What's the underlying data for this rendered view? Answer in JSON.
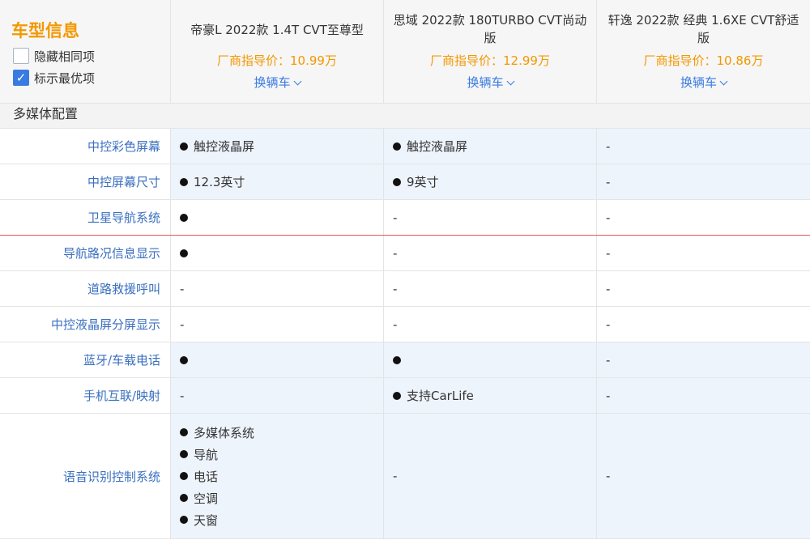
{
  "header": {
    "title": "车型信息",
    "hide_same_label": "隐藏相同项",
    "mark_best_label": "标示最优项",
    "hide_same_checked": false,
    "mark_best_checked": true
  },
  "cars": [
    {
      "name": "帝豪L 2022款 1.4T CVT至尊型",
      "price": "厂商指导价：10.99万",
      "switch": "换辆车"
    },
    {
      "name": "思域 2022款 180TURBO CVT尚动版",
      "price": "厂商指导价：12.99万",
      "switch": "换辆车"
    },
    {
      "name": "轩逸 2022款 经典 1.6XE CVT舒适版",
      "price": "厂商指导价：10.86万",
      "switch": "换辆车"
    }
  ],
  "section": {
    "title": "多媒体配置"
  },
  "rows": [
    {
      "label": "中控彩色屏幕",
      "values": [
        {
          "dot": true,
          "text": "触控液晶屏"
        },
        {
          "dot": true,
          "text": "触控液晶屏"
        },
        {
          "dot": false,
          "text": "-"
        }
      ]
    },
    {
      "label": "中控屏幕尺寸",
      "values": [
        {
          "dot": true,
          "text": "12.3英寸"
        },
        {
          "dot": true,
          "text": "9英寸"
        },
        {
          "dot": false,
          "text": "-"
        }
      ]
    },
    {
      "label": "卫星导航系统",
      "values": [
        {
          "dot": true,
          "text": ""
        },
        {
          "dot": false,
          "text": "-"
        },
        {
          "dot": false,
          "text": "-"
        }
      ]
    },
    {
      "label": "导航路况信息显示",
      "values": [
        {
          "dot": true,
          "text": ""
        },
        {
          "dot": false,
          "text": "-"
        },
        {
          "dot": false,
          "text": "-"
        }
      ]
    },
    {
      "label": "道路救援呼叫",
      "values": [
        {
          "dot": false,
          "text": "-"
        },
        {
          "dot": false,
          "text": "-"
        },
        {
          "dot": false,
          "text": "-"
        }
      ]
    },
    {
      "label": "中控液晶屏分屏显示",
      "values": [
        {
          "dot": false,
          "text": "-"
        },
        {
          "dot": false,
          "text": "-"
        },
        {
          "dot": false,
          "text": "-"
        }
      ]
    },
    {
      "label": "蓝牙/车载电话",
      "values": [
        {
          "dot": true,
          "text": ""
        },
        {
          "dot": true,
          "text": ""
        },
        {
          "dot": false,
          "text": "-"
        }
      ]
    },
    {
      "label": "手机互联/映射",
      "values": [
        {
          "dot": false,
          "text": "-"
        },
        {
          "dot": true,
          "text": "支持CarLife"
        },
        {
          "dot": false,
          "text": "-"
        }
      ]
    },
    {
      "label": "语音识别控制系统",
      "values": [
        {
          "list": [
            "多媒体系统",
            "导航",
            "电话",
            "空调",
            "天窗"
          ]
        },
        {
          "dot": false,
          "text": "-"
        },
        {
          "dot": false,
          "text": "-"
        }
      ]
    }
  ]
}
